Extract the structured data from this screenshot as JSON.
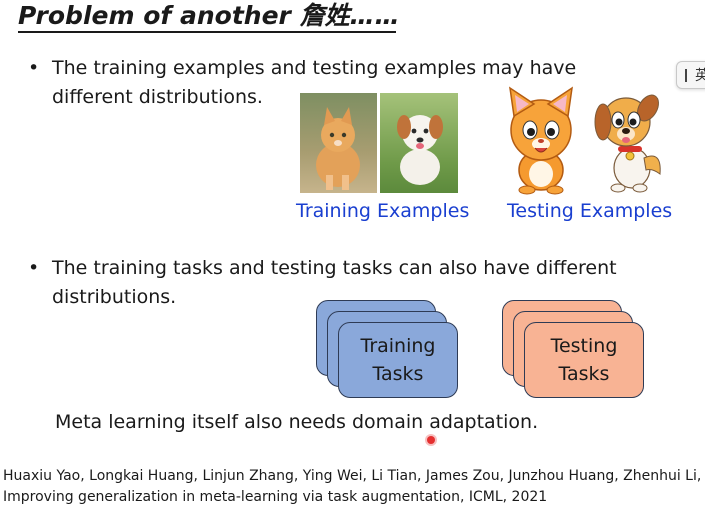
{
  "slide": {
    "title": "Problem of another 詹姓……",
    "bullet1": "The training examples and testing examples may have different distributions.",
    "bullet2": "The training tasks and testing tasks can also have different distributions.",
    "bullet_symbol": "•",
    "training_examples_label": "Training Examples",
    "testing_examples_label": "Testing Examples",
    "training_tasks_label": "Training Tasks",
    "testing_tasks_label": "Testing Tasks",
    "meta_statement": "Meta learning itself also needs domain adaptation.",
    "reference": "Huaxiu Yao, Longkai Huang, Linjun Zhang, Ying Wei, Li Tian, James Zou, Junzhou Huang, Zhenhui Li, Improving generalization in meta-learning via task augmentation, ICML, 2021"
  },
  "ime_indicator": {
    "char": "英"
  },
  "colors": {
    "caption_blue": "#1a3fd0",
    "training_task_fill": "#8aa8da",
    "testing_task_fill": "#f8b394",
    "cursor_red": "#e53030"
  },
  "icons": [
    "kitten-photo",
    "puppy-photo",
    "cartoon-cat-icon",
    "cartoon-dog-icon"
  ]
}
